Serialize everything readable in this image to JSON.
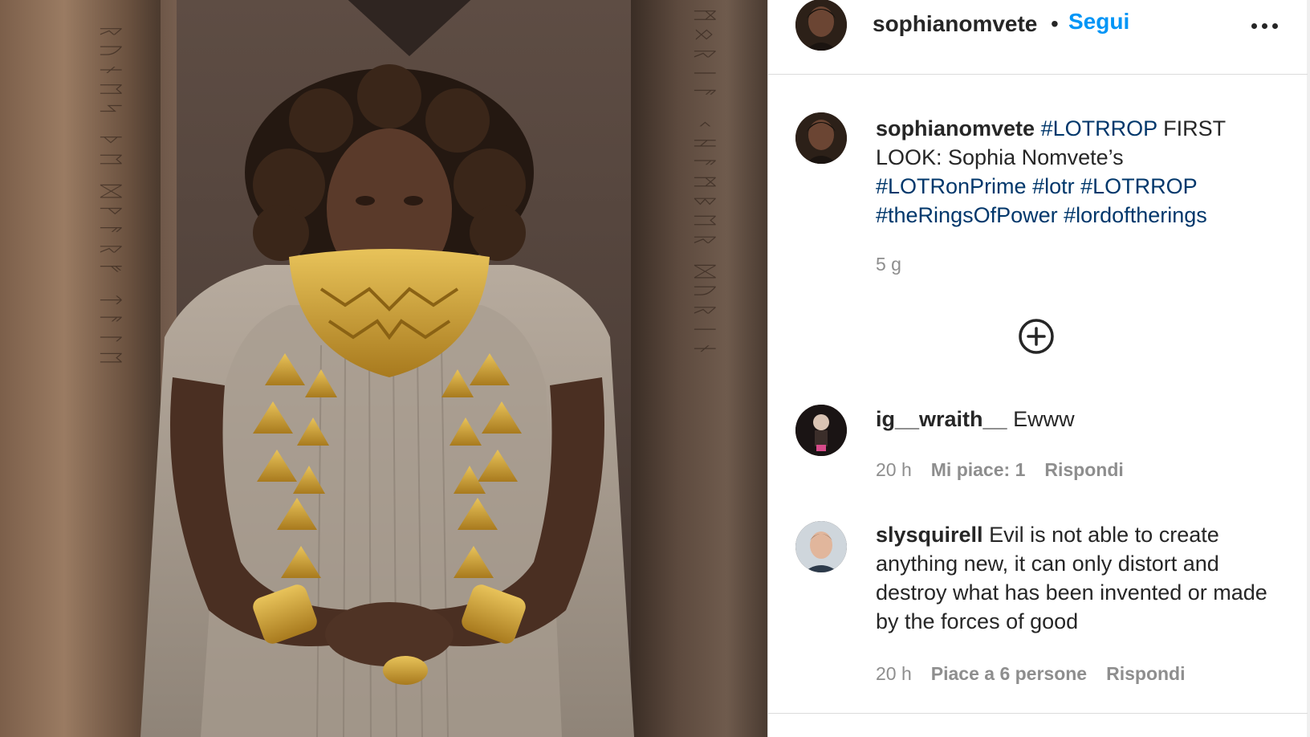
{
  "post": {
    "username": "sophianomvete",
    "separator": "•",
    "follow_label": "Segui",
    "more_icon": "more-horizontal-icon",
    "caption": {
      "username": "sophianomvete",
      "tag1": "#LOTRROP",
      "text1": "FIRST LOOK: Sophia Nomvete’s",
      "tag2": "#LOTRonPrime",
      "tag3": "#lotr",
      "tag4": "#LOTRROP",
      "tag5": "#theRingsOfPower",
      "tag6": "#lordoftherings",
      "time": "5 g"
    },
    "load_more_icon": "plus-circle-icon"
  },
  "comments": [
    {
      "username": "ig__wraith__",
      "text": "Ewww",
      "time": "20 h",
      "likes": "Mi piace: 1",
      "reply": "Rispondi"
    },
    {
      "username": "slysquirell",
      "text": "Evil is not able to create anything new, it can only distort and destroy what has been invented or made by the forces of good",
      "time": "20 h",
      "likes": "Piace a 6 persone",
      "reply": "Rispondi"
    }
  ],
  "colors": {
    "link_blue": "#0095f6",
    "hashtag": "#00376b",
    "muted": "#8e8e8e",
    "border": "#dbdbdb"
  }
}
